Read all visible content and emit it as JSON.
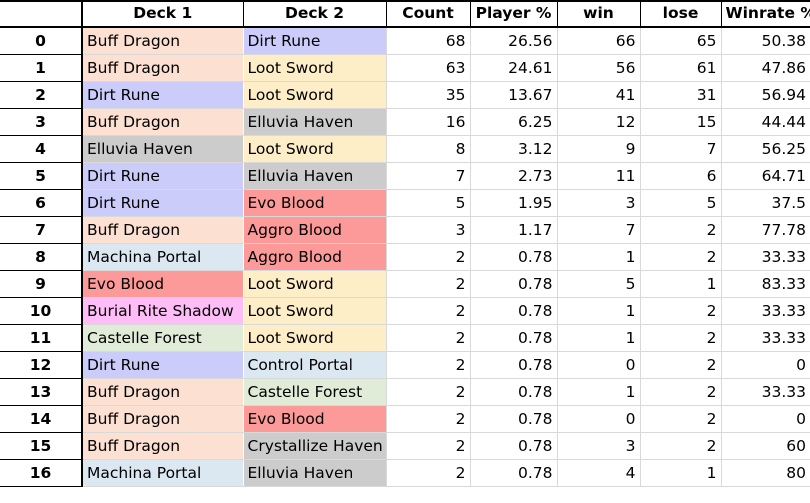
{
  "table": {
    "columns": [
      {
        "key": "index",
        "label": "",
        "name": "column-header-index"
      },
      {
        "key": "deck1",
        "label": "Deck 1",
        "name": "column-header-deck-1"
      },
      {
        "key": "deck2",
        "label": "Deck 2",
        "name": "column-header-deck-2"
      },
      {
        "key": "count",
        "label": "Count",
        "name": "column-header-count"
      },
      {
        "key": "player",
        "label": "Player %",
        "name": "column-header-player-pct"
      },
      {
        "key": "win",
        "label": "win",
        "name": "column-header-win"
      },
      {
        "key": "lose",
        "label": "lose",
        "name": "column-header-lose"
      },
      {
        "key": "winrate",
        "label": "Winrate %",
        "name": "column-header-winrate-pct"
      }
    ],
    "deck_colors": {
      "Buff Dragon": "#fce0d2",
      "Dirt Rune": "#ccccfa",
      "Loot Sword": "#fdeec7",
      "Elluvia Haven": "#cccccc",
      "Evo Blood": "#fb9a98",
      "Aggro Blood": "#fb9a98",
      "Machina Portal": "#dbe8f2",
      "Burial Rite Shadow": "#febdf7",
      "Castelle Forest": "#e0ecd7",
      "Control Portal": "#dbe8f2",
      "Crystallize Haven": "#cccccc"
    },
    "rows": [
      {
        "index": "0",
        "deck1": "Buff Dragon",
        "deck2": "Dirt Rune",
        "count": "68",
        "player": "26.56",
        "win": "66",
        "lose": "65",
        "winrate": "50.38"
      },
      {
        "index": "1",
        "deck1": "Buff Dragon",
        "deck2": "Loot Sword",
        "count": "63",
        "player": "24.61",
        "win": "56",
        "lose": "61",
        "winrate": "47.86"
      },
      {
        "index": "2",
        "deck1": "Dirt Rune",
        "deck2": "Loot Sword",
        "count": "35",
        "player": "13.67",
        "win": "41",
        "lose": "31",
        "winrate": "56.94"
      },
      {
        "index": "3",
        "deck1": "Buff Dragon",
        "deck2": "Elluvia Haven",
        "count": "16",
        "player": "6.25",
        "win": "12",
        "lose": "15",
        "winrate": "44.44"
      },
      {
        "index": "4",
        "deck1": "Elluvia Haven",
        "deck2": "Loot Sword",
        "count": "8",
        "player": "3.12",
        "win": "9",
        "lose": "7",
        "winrate": "56.25"
      },
      {
        "index": "5",
        "deck1": "Dirt Rune",
        "deck2": "Elluvia Haven",
        "count": "7",
        "player": "2.73",
        "win": "11",
        "lose": "6",
        "winrate": "64.71"
      },
      {
        "index": "6",
        "deck1": "Dirt Rune",
        "deck2": "Evo Blood",
        "count": "5",
        "player": "1.95",
        "win": "3",
        "lose": "5",
        "winrate": "37.5"
      },
      {
        "index": "7",
        "deck1": "Buff Dragon",
        "deck2": "Aggro Blood",
        "count": "3",
        "player": "1.17",
        "win": "7",
        "lose": "2",
        "winrate": "77.78"
      },
      {
        "index": "8",
        "deck1": "Machina Portal",
        "deck2": "Aggro Blood",
        "count": "2",
        "player": "0.78",
        "win": "1",
        "lose": "2",
        "winrate": "33.33"
      },
      {
        "index": "9",
        "deck1": "Evo Blood",
        "deck2": "Loot Sword",
        "count": "2",
        "player": "0.78",
        "win": "5",
        "lose": "1",
        "winrate": "83.33"
      },
      {
        "index": "10",
        "deck1": "Burial Rite Shadow",
        "deck2": "Loot Sword",
        "count": "2",
        "player": "0.78",
        "win": "1",
        "lose": "2",
        "winrate": "33.33"
      },
      {
        "index": "11",
        "deck1": "Castelle Forest",
        "deck2": "Loot Sword",
        "count": "2",
        "player": "0.78",
        "win": "1",
        "lose": "2",
        "winrate": "33.33"
      },
      {
        "index": "12",
        "deck1": "Dirt Rune",
        "deck2": "Control Portal",
        "count": "2",
        "player": "0.78",
        "win": "0",
        "lose": "2",
        "winrate": "0"
      },
      {
        "index": "13",
        "deck1": "Buff Dragon",
        "deck2": "Castelle Forest",
        "count": "2",
        "player": "0.78",
        "win": "1",
        "lose": "2",
        "winrate": "33.33"
      },
      {
        "index": "14",
        "deck1": "Buff Dragon",
        "deck2": "Evo Blood",
        "count": "2",
        "player": "0.78",
        "win": "0",
        "lose": "2",
        "winrate": "0"
      },
      {
        "index": "15",
        "deck1": "Buff Dragon",
        "deck2": "Crystallize Haven",
        "count": "2",
        "player": "0.78",
        "win": "3",
        "lose": "2",
        "winrate": "60"
      },
      {
        "index": "16",
        "deck1": "Machina Portal",
        "deck2": "Elluvia Haven",
        "count": "2",
        "player": "0.78",
        "win": "4",
        "lose": "1",
        "winrate": "80"
      }
    ]
  }
}
